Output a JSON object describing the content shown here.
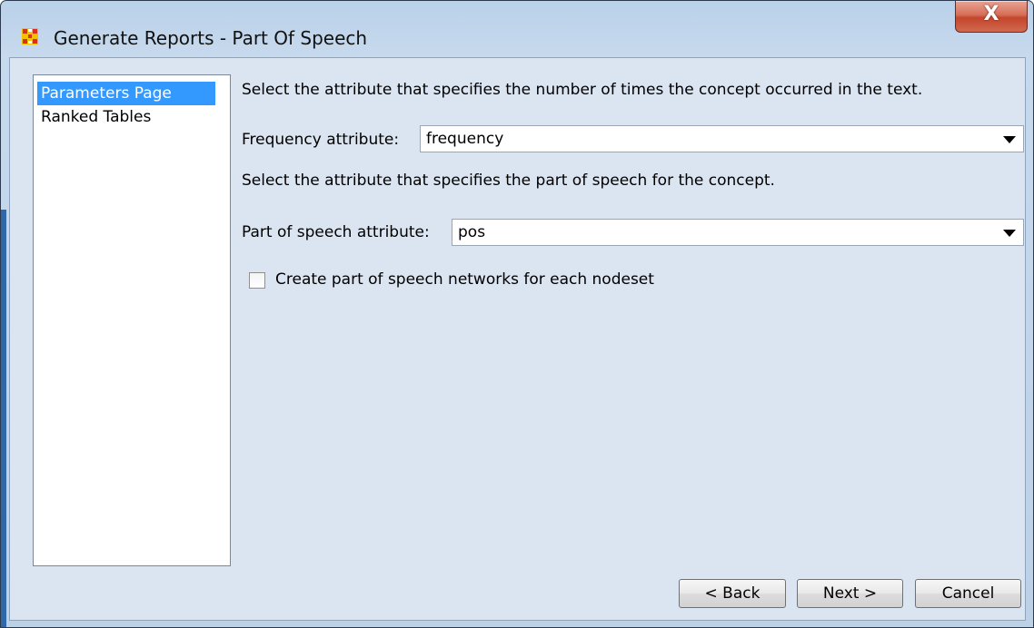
{
  "window": {
    "title": "Generate Reports - Part Of Speech",
    "close_label": "X"
  },
  "sidebar": {
    "items": [
      {
        "label": "Parameters Page",
        "selected": true
      },
      {
        "label": "Ranked Tables",
        "selected": false
      }
    ]
  },
  "main": {
    "frequency_instruction": "Select the attribute that specifies the number of times the concept occurred in the text.",
    "frequency_label": "Frequency attribute:",
    "frequency_value": "frequency",
    "pos_instruction": "Select the attribute that specifies the part of speech for the concept.",
    "pos_label": "Part of speech attribute:",
    "pos_value": "pos",
    "checkbox_label": "Create part of speech networks for each nodeset",
    "checkbox_checked": false
  },
  "buttons": {
    "back": "< Back",
    "next": "Next >",
    "cancel": "Cancel"
  },
  "colors": {
    "selection": "#3399ff",
    "client_bg": "#dbe5f1"
  },
  "icons": {
    "app": "grid-app-icon",
    "close": "close-icon",
    "dropdown": "chevron-down-icon"
  }
}
